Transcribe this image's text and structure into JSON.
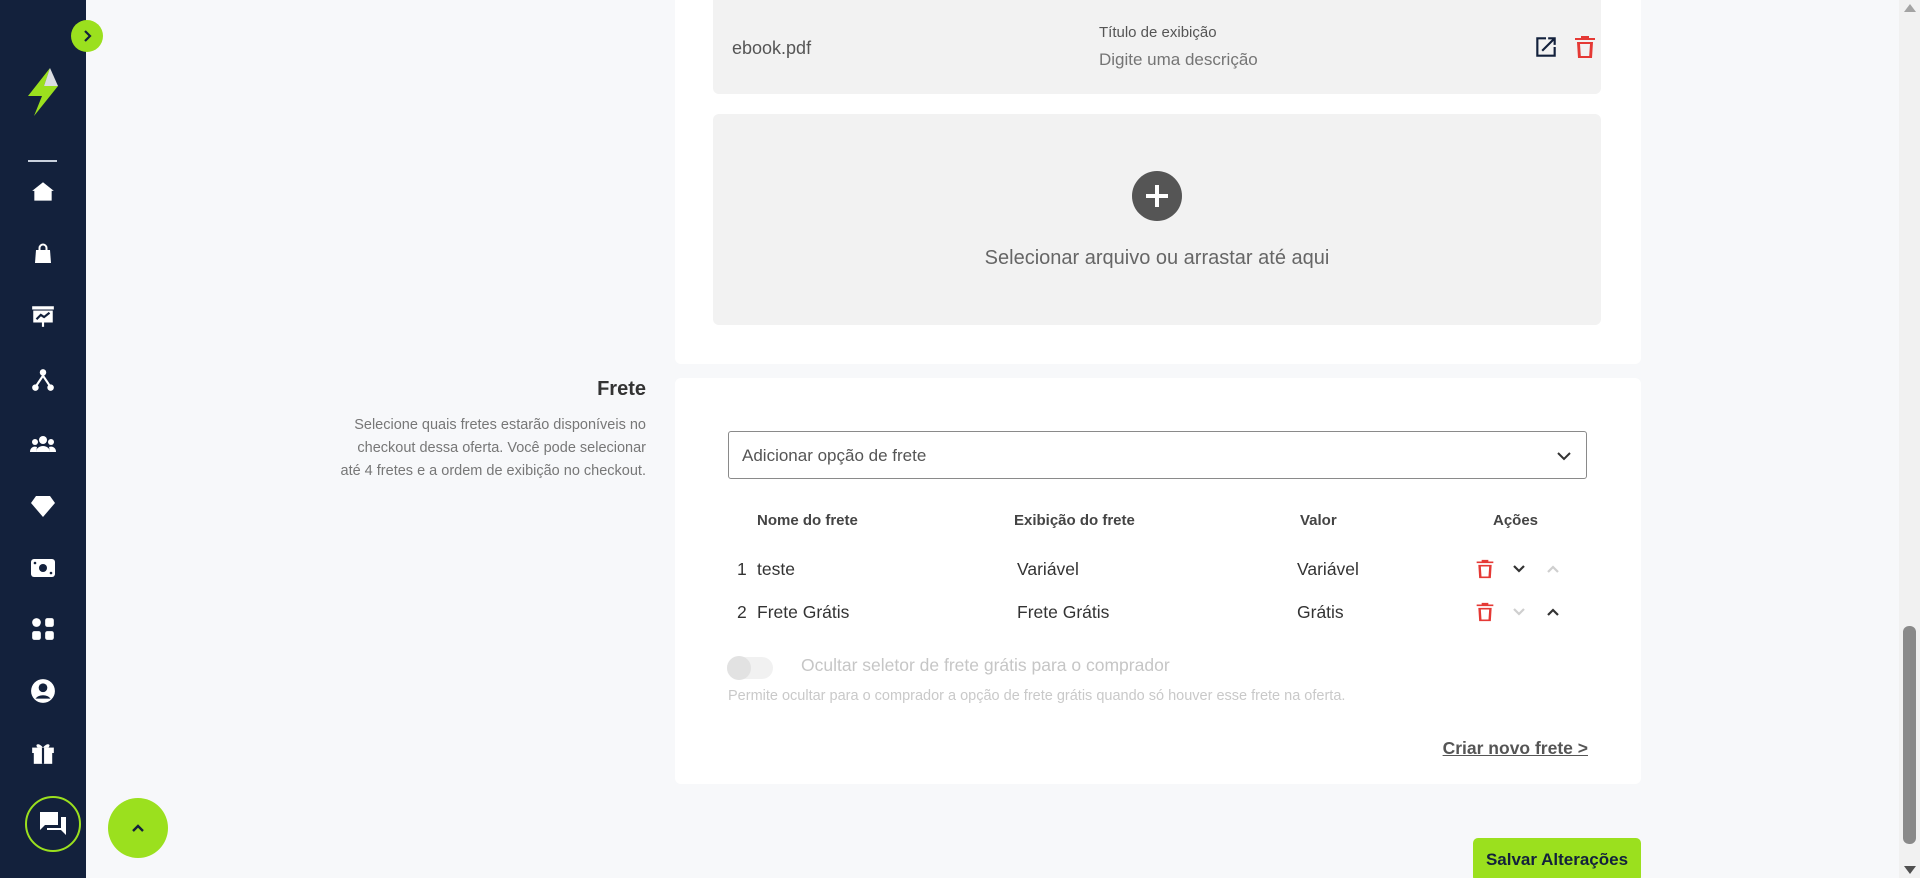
{
  "colors": {
    "accent": "#9be01e",
    "sidebar": "#13213c",
    "danger": "#e53935"
  },
  "sidebar": {
    "items": [
      {
        "name": "home",
        "icon": "home-icon"
      },
      {
        "name": "products",
        "icon": "shopping-bag-icon"
      },
      {
        "name": "dashboard",
        "icon": "presentation-chart-icon"
      },
      {
        "name": "affiliates",
        "icon": "network-icon"
      },
      {
        "name": "customers",
        "icon": "users-icon"
      },
      {
        "name": "members",
        "icon": "diamond-icon"
      },
      {
        "name": "financial",
        "icon": "cash-icon"
      },
      {
        "name": "apps",
        "icon": "apps-grid-icon"
      },
      {
        "name": "account",
        "icon": "user-circle-icon"
      },
      {
        "name": "rewards",
        "icon": "gift-icon"
      }
    ]
  },
  "upload": {
    "file_name": "ebook.pdf",
    "display_title_label": "Título de exibição",
    "display_title_placeholder": "Digite uma descrição",
    "dropzone_text": "Selecionar arquivo ou arrastar até aqui"
  },
  "frete": {
    "title": "Frete",
    "description": "Selecione quais fretes estarão disponíveis no checkout dessa oferta. Você pode selecionar até 4 fretes e a ordem de exibição no checkout.",
    "select_placeholder": "Adicionar opção de frete",
    "columns": [
      "Nome do frete",
      "Exibição do frete",
      "Valor",
      "Ações"
    ],
    "rows": [
      {
        "index": "1",
        "name": "teste",
        "display": "Variável",
        "value": "Variável"
      },
      {
        "index": "2",
        "name": "Frete Grátis",
        "display": "Frete Grátis",
        "value": "Grátis"
      }
    ],
    "toggle_label": "Ocultar seletor de frete grátis para o comprador",
    "toggle_help": "Permite ocultar para o comprador a opção de frete grátis quando só houver esse frete na oferta.",
    "create_link": "Criar novo frete >"
  },
  "save_button": "Salvar Alterações"
}
